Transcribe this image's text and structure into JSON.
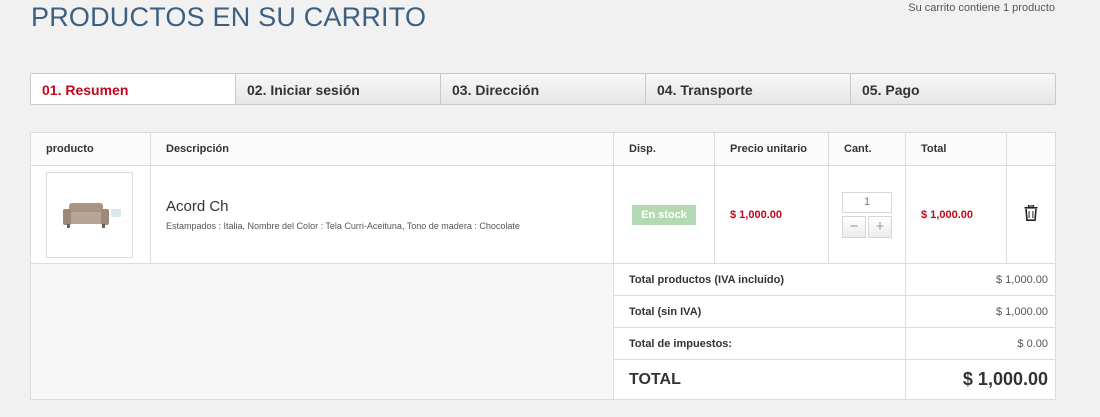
{
  "page": {
    "title": "PRODUCTOS EN SU CARRITO",
    "cart_count_text": "Su carrito contiene 1 producto"
  },
  "steps": [
    {
      "label": "01. Resumen",
      "active": true
    },
    {
      "label": "02. Iniciar sesión",
      "active": false
    },
    {
      "label": "03. Dirección",
      "active": false
    },
    {
      "label": "04. Transporte",
      "active": false
    },
    {
      "label": "05. Pago",
      "active": false
    }
  ],
  "table": {
    "headers": {
      "product": "producto",
      "description": "Descripción",
      "availability": "Disp.",
      "unit_price": "Precio unitario",
      "quantity": "Cant.",
      "total": "Total"
    },
    "item": {
      "name": "Acord Ch",
      "attributes": "Estampados : Italia, Nombre del Color : Tela Curri-Aceituna, Tono de madera : Chocolate",
      "availability": "En stock",
      "unit_price": "$ 1,000.00",
      "quantity": "1",
      "total": "$ 1,000.00",
      "minus": "−",
      "plus": "+",
      "delete_icon": "trash-icon"
    },
    "summary": {
      "products_label": "Total productos (IVA incluido)",
      "products_value": "$ 1,000.00",
      "no_tax_label": "Total (sin IVA)",
      "no_tax_value": "$ 1,000.00",
      "taxes_label": "Total de impuestos:",
      "taxes_value": "$ 0.00",
      "total_label": "TOTAL",
      "total_value": "$ 1,000.00"
    }
  },
  "colors": {
    "title": "#3d5f80",
    "accent_red": "#c2061c",
    "stock_green": "#b3d9b2"
  }
}
